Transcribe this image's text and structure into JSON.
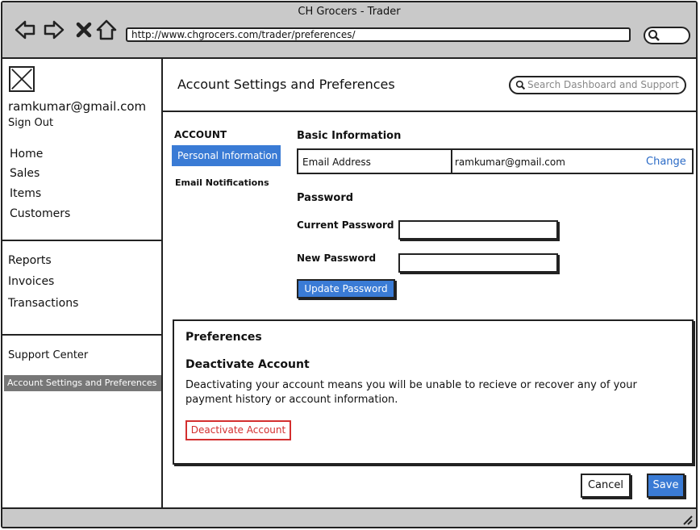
{
  "window": {
    "title": "CH Grocers - Trader"
  },
  "browser": {
    "url": "http://www.chgrocers.com/trader/preferences/"
  },
  "sidebar": {
    "email": "ramkumar@gmail.com",
    "signout": "Sign Out",
    "group1": [
      "Home",
      "Sales",
      "Items",
      "Customers"
    ],
    "group2": [
      "Reports",
      "Invoices",
      "Transactions"
    ],
    "group3": [
      "Support Center"
    ],
    "selected": "Account Settings and Preferences"
  },
  "header": {
    "title": "Account Settings and Preferences",
    "search_placeholder": "Search Dashboard and Support"
  },
  "tabs": {
    "heading": "ACCOUNT",
    "items": [
      "Personal Information",
      "Email Notifications"
    ]
  },
  "basic": {
    "heading": "Basic Information",
    "email_label": "Email Address",
    "email_value": "ramkumar@gmail.com",
    "change_link": "Change"
  },
  "password": {
    "heading": "Password",
    "current_label": "Current Password",
    "new_label": "New Password",
    "update_button": "Update Password"
  },
  "preferences": {
    "heading": "Preferences",
    "deactivate_heading": "Deactivate Account",
    "deactivate_text": "Deactivating your account means you will be unable to recieve or recover any of your payment history or account information.",
    "deactivate_button": "Deactivate Account"
  },
  "footer": {
    "cancel": "Cancel",
    "save": "Save"
  }
}
